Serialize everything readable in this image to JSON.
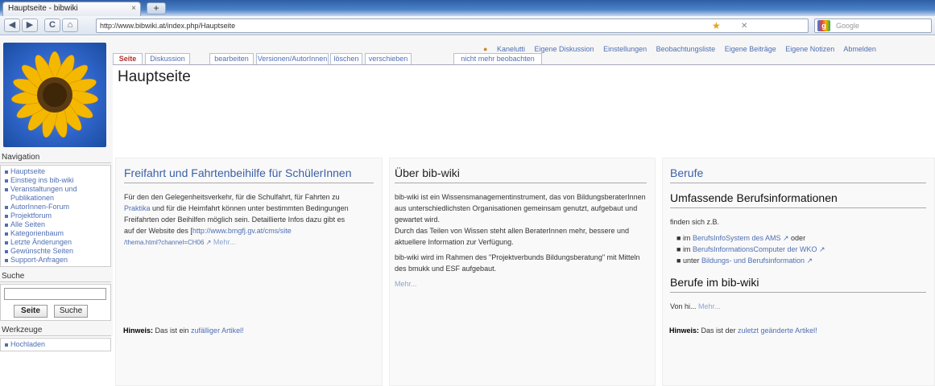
{
  "browser": {
    "tab_title": "Hauptseite - bibwiki",
    "tab_close": "×",
    "new_tab": "+",
    "url": "http://www.bibwiki.at/index.php/Hauptseite",
    "search_placeholder": "Google",
    "search_logo": "g",
    "nav_back": "◀",
    "nav_forward": "▶",
    "nav_reload": "C",
    "nav_home": "⌂",
    "star": "★",
    "stop": "✕"
  },
  "personal": {
    "items": [
      "Kanelutti",
      "Eigene Diskussion",
      "Einstellungen",
      "Beobachtungsliste",
      "Eigene Beiträge",
      "Eigene Notizen",
      "Abmelden"
    ]
  },
  "tabs": [
    "Seite",
    "Diskussion",
    "bearbeiten",
    "Versionen/AutorInnen",
    "löschen",
    "verschieben",
    "nicht mehr beobachten"
  ],
  "page": {
    "title": "Hauptseite"
  },
  "panels": {
    "freifahrt": {
      "heading": "Freifahrt und Fahrtenbeihilfe für SchülerInnen",
      "t1": "Für den den Gelegenheitsverkehr, für die Schulfahrt, für Fahrten zu",
      "t2a": "Praktika",
      "t2b": " und für die Heimfahrt können unter bestimmten Bedingungen",
      "t3": "Freifahrten oder Beihilfen möglich sein. Detaillierte Infos dazu gibt es",
      "t4a": "auf der Website des [",
      "t4b": "http://www.bmgfj.gv.at/cms/site",
      "t5": "/thema.html?channel=CH06",
      "t5b": " Mehr..."
    },
    "ueber": {
      "heading": "Über bib-wiki",
      "p1": "bib-wiki ist ein Wissensmanagementinstrument, das von BildungsberaterInnen aus unterschiedlichsten Organisationen gemeinsam genutzt, aufgebaut und gewartet wird.",
      "p2": "Durch das Teilen von Wissen steht allen BeraterInnen mehr, bessere und aktuellere Information zur Verfügung.",
      "p3": "bib-wiki wird im Rahmen des \"Projektverbunds Bildungsberatung\" mit Mitteln des bmukk und ESF aufgebaut.",
      "more": "Mehr..."
    },
    "berufe": {
      "heading": "Berufe",
      "sub1": "Umfassende Berufsinformationen",
      "intro": "finden sich z.B.",
      "l1a": "im ",
      "l1b": "BerufsInfoSystem des AMS",
      "l1c": " oder",
      "l2a": "im ",
      "l2b": "BerufsInformationsComputer der WKO",
      "l3a": "unter ",
      "l3b": "Bildungs- und Berufsinformation",
      "sub2": "Berufe im bib-wiki",
      "von": "Von hi... ",
      "more": "Mehr..."
    },
    "hinweis_left": {
      "bold": "Hinweis:",
      "text": " Das ist ein ",
      "link": "zufälliger Artikel!"
    },
    "hinweis_right": {
      "bold": "Hinweis:",
      "text": " Das ist der ",
      "link": "zuletzt geänderte Artikel!"
    }
  },
  "sidebar": {
    "nav_heading": "Navigation",
    "nav_items": [
      "Hauptseite",
      "Einstieg ins bib-wiki",
      "Veranstaltungen und Publikationen",
      "AutorInnen-Forum",
      "Projektforum",
      "Alle Seiten",
      "Kategorienbaum",
      "Letzte Änderungen",
      "Gewünschte Seiten",
      "Support-Anfragen"
    ],
    "search_heading": "Suche",
    "search_go": "Seite",
    "search_btn": "Suche",
    "tools_heading": "Werkzeuge",
    "tools_items": [
      "Hochladen"
    ]
  }
}
